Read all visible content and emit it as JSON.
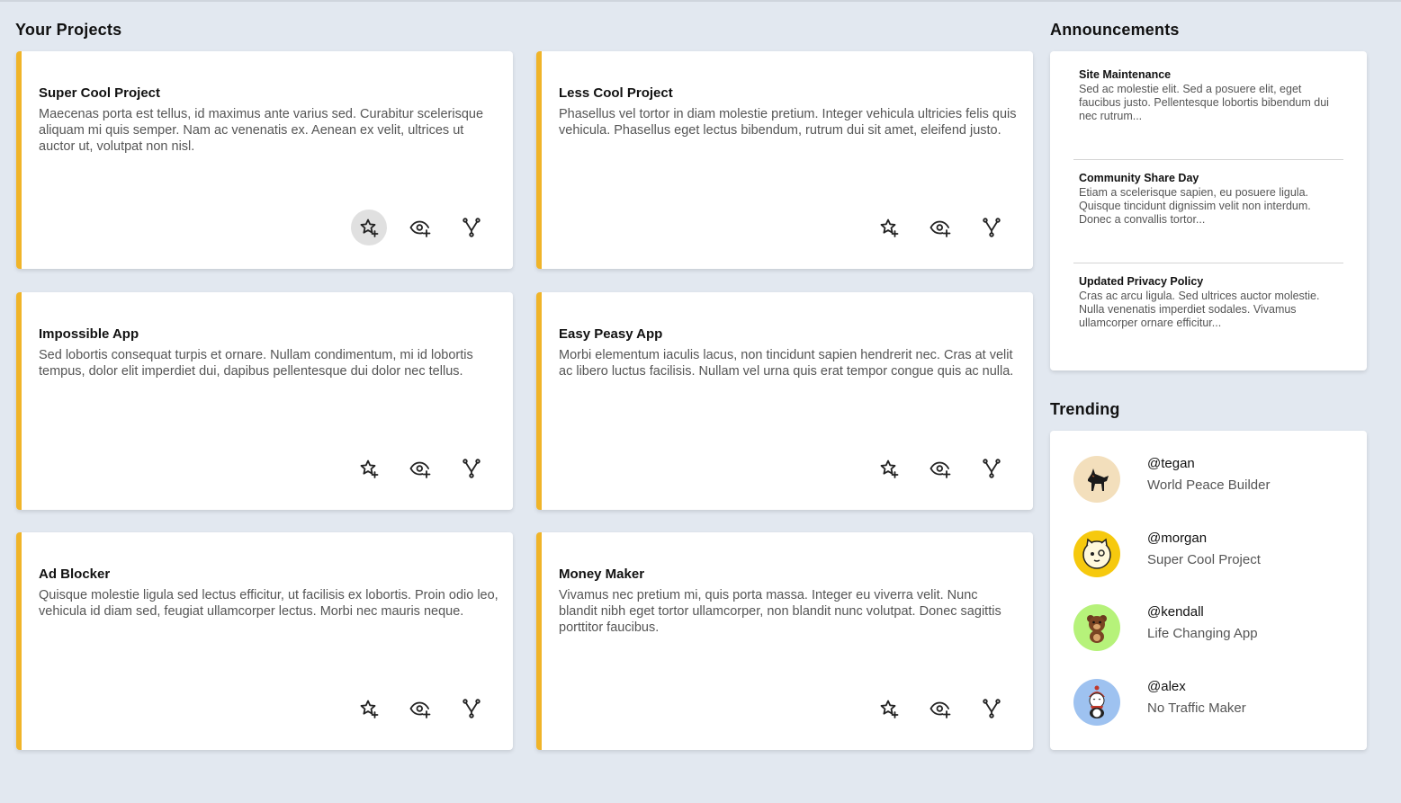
{
  "projects_title": "Your Projects",
  "projects": [
    {
      "title": "Super Cool Project",
      "desc": "Maecenas porta est tellus, id maximus ante varius sed. Curabitur scelerisque aliquam mi quis semper. Nam ac venenatis ex. Aenean ex velit, ultrices ut auctor ut, volutpat non nisl."
    },
    {
      "title": "Less Cool Project",
      "desc": "Phasellus vel tortor in diam molestie pretium. Integer vehicula ultricies felis quis vehicula. Phasellus eget lectus bibendum, rutrum dui sit amet, eleifend justo."
    },
    {
      "title": "Impossible App",
      "desc": "Sed lobortis consequat turpis et ornare. Nullam condimentum, mi id lobortis tempus, dolor elit imperdiet dui, dapibus pellentesque dui dolor nec tellus."
    },
    {
      "title": "Easy Peasy App",
      "desc": "Morbi elementum iaculis lacus, non tincidunt sapien hendrerit nec. Cras at velit ac libero luctus facilisis. Nullam vel urna quis erat tempor congue quis ac nulla."
    },
    {
      "title": "Ad Blocker",
      "desc": "Quisque molestie ligula sed lectus efficitur, ut facilisis ex lobortis. Proin odio leo, vehicula id diam sed, feugiat ullamcorper lectus. Morbi nec mauris neque."
    },
    {
      "title": "Money Maker",
      "desc": "Vivamus nec pretium mi, quis porta massa. Integer eu viverra velit. Nunc blandit nibh eget tortor ullamcorper, non blandit nunc volutpat. Donec sagittis porttitor faucibus."
    }
  ],
  "card_actions": {
    "star_icon": "star-plus-icon",
    "watch_icon": "eye-plus-icon",
    "fork_icon": "fork-icon"
  },
  "accent_color": "#f0b429",
  "announcements_title": "Announcements",
  "announcements": [
    {
      "title": "Site Maintenance",
      "body": "Sed ac molestie elit. Sed a posuere elit, eget faucibus justo. Pellentesque lobortis bibendum dui nec rutrum..."
    },
    {
      "title": "Community Share Day",
      "body": "Etiam a scelerisque sapien, eu posuere ligula. Quisque tincidunt dignissim velit non interdum. Donec a convallis tortor..."
    },
    {
      "title": "Updated Privacy Policy",
      "body": "Cras ac arcu ligula. Sed ultrices auctor molestie. Nulla venenatis imperdiet sodales. Vivamus ullamcorper ornare efficitur..."
    }
  ],
  "trending_title": "Trending",
  "trending": [
    {
      "handle": "@tegan",
      "project": "World Peace Builder",
      "avatar_color": "#f3dfbc",
      "avatar_icon": "dog-icon"
    },
    {
      "handle": "@morgan",
      "project": "Super Cool Project",
      "avatar_color": "#f6c90e",
      "avatar_icon": "cat-icon"
    },
    {
      "handle": "@kendall",
      "project": "Life Changing App",
      "avatar_color": "#b6f27a",
      "avatar_icon": "bear-icon"
    },
    {
      "handle": "@alex",
      "project": "No Traffic Maker",
      "avatar_color": "#9ec2f0",
      "avatar_icon": "penguin-icon"
    }
  ]
}
